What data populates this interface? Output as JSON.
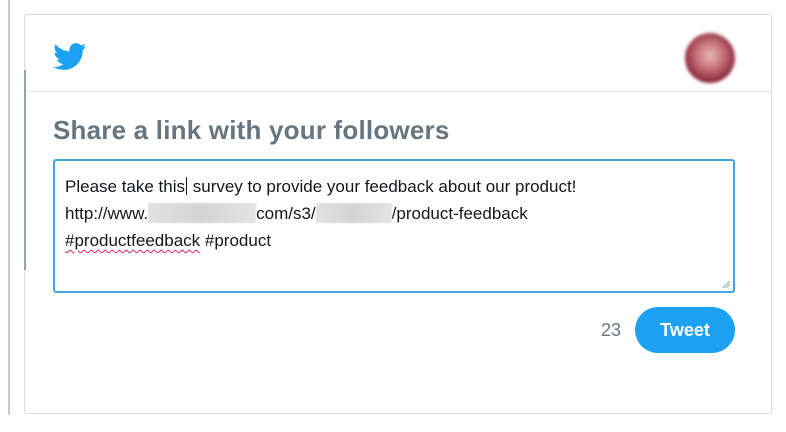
{
  "header": {
    "logo_icon": "twitter-bird-icon",
    "avatar": "user-avatar"
  },
  "main": {
    "title": "Share a link with your followers",
    "tweet": {
      "line1_before_caret": "Please take this",
      "line1_after_caret": " survey to provide your feedback about our product!",
      "line2_prefix": "http://www.",
      "line2_middle": "com/s3/",
      "line2_suffix": "/product-feedback",
      "line3_hashtag1": "#productfeedback",
      "line3_hashtag2": " #product"
    },
    "char_count": "23",
    "tweet_button_label": "Tweet"
  },
  "colors": {
    "brand_blue": "#1da1f2",
    "focus_border": "#4aa3df",
    "title_gray": "#66757f"
  }
}
